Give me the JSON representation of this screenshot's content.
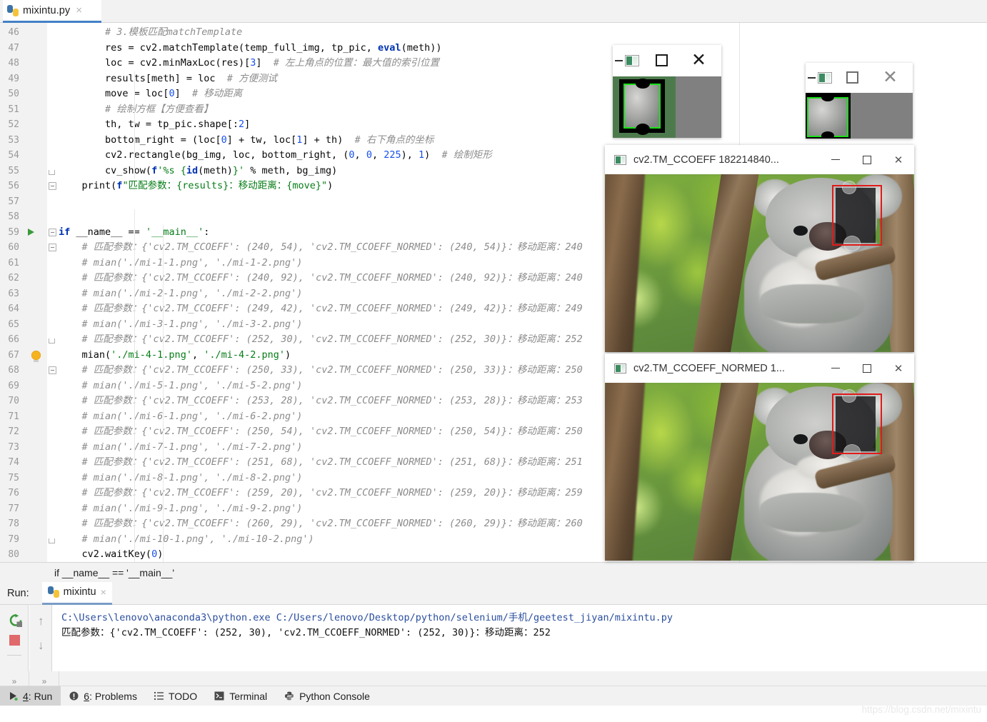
{
  "window": {
    "tab": {
      "filename": "mixintu.py",
      "close": "×",
      "icon": "python-file-icon"
    }
  },
  "editor": {
    "lines": [
      {
        "n": 46,
        "indent": 2,
        "segs": [
          {
            "t": "# 3.模板匹配matchTemplate",
            "c": "cmt"
          }
        ]
      },
      {
        "n": 47,
        "indent": 2,
        "segs": [
          {
            "t": "res = cv2.matchTemplate(temp_full_img, tp_pic, ",
            "c": ""
          },
          {
            "t": "eval",
            "c": "kw"
          },
          {
            "t": "(meth))",
            "c": ""
          }
        ]
      },
      {
        "n": 48,
        "indent": 2,
        "segs": [
          {
            "t": "loc = cv2.minMaxLoc(res)[",
            "c": ""
          },
          {
            "t": "3",
            "c": "num"
          },
          {
            "t": "]  ",
            "c": ""
          },
          {
            "t": "# 左上角点的位置：最大值的索引位置",
            "c": "cmt"
          }
        ]
      },
      {
        "n": 49,
        "indent": 2,
        "segs": [
          {
            "t": "results[meth] = loc  ",
            "c": ""
          },
          {
            "t": "# 方便测试",
            "c": "cmt"
          }
        ]
      },
      {
        "n": 50,
        "indent": 2,
        "segs": [
          {
            "t": "move = loc[",
            "c": ""
          },
          {
            "t": "0",
            "c": "num"
          },
          {
            "t": "]  ",
            "c": ""
          },
          {
            "t": "# 移动距离",
            "c": "cmt"
          }
        ]
      },
      {
        "n": 51,
        "indent": 2,
        "segs": [
          {
            "t": "# 绘制方框【方便查看】",
            "c": "cmt"
          }
        ]
      },
      {
        "n": 52,
        "indent": 2,
        "segs": [
          {
            "t": "th, tw = tp_pic.shape[:",
            "c": ""
          },
          {
            "t": "2",
            "c": "num"
          },
          {
            "t": "]",
            "c": ""
          }
        ]
      },
      {
        "n": 53,
        "indent": 2,
        "segs": [
          {
            "t": "bottom_right = (loc[",
            "c": ""
          },
          {
            "t": "0",
            "c": "num"
          },
          {
            "t": "] + tw, loc[",
            "c": ""
          },
          {
            "t": "1",
            "c": "num"
          },
          {
            "t": "] + th)  ",
            "c": ""
          },
          {
            "t": "# 右下角点的坐标",
            "c": "cmt"
          }
        ]
      },
      {
        "n": 54,
        "indent": 2,
        "segs": [
          {
            "t": "cv2.rectangle(bg_img, loc, bottom_right, (",
            "c": ""
          },
          {
            "t": "0",
            "c": "num"
          },
          {
            "t": ", ",
            "c": ""
          },
          {
            "t": "0",
            "c": "num"
          },
          {
            "t": ", ",
            "c": ""
          },
          {
            "t": "225",
            "c": "num"
          },
          {
            "t": "), ",
            "c": ""
          },
          {
            "t": "1",
            "c": "num"
          },
          {
            "t": ")  ",
            "c": ""
          },
          {
            "t": "# 绘制矩形",
            "c": "cmt"
          }
        ]
      },
      {
        "n": 55,
        "indent": 2,
        "segs": [
          {
            "t": "cv_show(",
            "c": ""
          },
          {
            "t": "f",
            "c": "kw"
          },
          {
            "t": "'%s {",
            "c": "str"
          },
          {
            "t": "id",
            "c": "kw"
          },
          {
            "t": "(meth)",
            "c": ""
          },
          {
            "t": "}'",
            "c": "str"
          },
          {
            "t": " % meth, bg_img)",
            "c": ""
          }
        ]
      },
      {
        "n": 56,
        "indent": 1,
        "segs": [
          {
            "t": "print(",
            "c": ""
          },
          {
            "t": "f",
            "c": "kw"
          },
          {
            "t": "\"匹配参数：{results}：移动距离：{move}\"",
            "c": "str"
          },
          {
            "t": ")",
            "c": ""
          }
        ]
      },
      {
        "n": 57,
        "indent": 0,
        "segs": []
      },
      {
        "n": 58,
        "indent": 0,
        "segs": []
      },
      {
        "n": 59,
        "indent": 0,
        "segs": [
          {
            "t": "if",
            "c": "kw"
          },
          {
            "t": " __name__ == ",
            "c": ""
          },
          {
            "t": "'__main__'",
            "c": "str"
          },
          {
            "t": ":",
            "c": ""
          }
        ]
      },
      {
        "n": 60,
        "indent": 1,
        "segs": [
          {
            "t": "# 匹配参数：{'cv2.TM_CCOEFF': (240, 54), 'cv2.TM_CCOEFF_NORMED': (240, 54)}：移动距离：240",
            "c": "cmt"
          }
        ]
      },
      {
        "n": 61,
        "indent": 1,
        "segs": [
          {
            "t": "# mian('./mi-1-1.png', './mi-1-2.png')",
            "c": "cmt"
          }
        ]
      },
      {
        "n": 62,
        "indent": 1,
        "segs": [
          {
            "t": "# 匹配参数：{'cv2.TM_CCOEFF': (240, 92), 'cv2.TM_CCOEFF_NORMED': (240, 92)}：移动距离：240",
            "c": "cmt"
          }
        ]
      },
      {
        "n": 63,
        "indent": 1,
        "segs": [
          {
            "t": "# mian('./mi-2-1.png', './mi-2-2.png')",
            "c": "cmt"
          }
        ]
      },
      {
        "n": 64,
        "indent": 1,
        "segs": [
          {
            "t": "# 匹配参数：{'cv2.TM_CCOEFF': (249, 42), 'cv2.TM_CCOEFF_NORMED': (249, 42)}：移动距离：249",
            "c": "cmt"
          }
        ]
      },
      {
        "n": 65,
        "indent": 1,
        "segs": [
          {
            "t": "# mian('./mi-3-1.png', './mi-3-2.png')",
            "c": "cmt"
          }
        ]
      },
      {
        "n": 66,
        "indent": 1,
        "segs": [
          {
            "t": "# 匹配参数：{'cv2.TM_CCOEFF': (252, 30), 'cv2.TM_CCOEFF_NORMED': (252, 30)}：移动距离：252",
            "c": "cmt"
          }
        ]
      },
      {
        "n": 67,
        "indent": 1,
        "segs": [
          {
            "t": "mian(",
            "c": ""
          },
          {
            "t": "'./mi-4-1.png'",
            "c": "str"
          },
          {
            "t": ", ",
            "c": ""
          },
          {
            "t": "'./mi-4-2.png'",
            "c": "str"
          },
          {
            "t": ")",
            "c": ""
          }
        ]
      },
      {
        "n": 68,
        "indent": 1,
        "segs": [
          {
            "t": "# 匹配参数：{'cv2.TM_CCOEFF': (250, 33), 'cv2.TM_CCOEFF_NORMED': (250, 33)}：移动距离：250",
            "c": "cmt"
          }
        ]
      },
      {
        "n": 69,
        "indent": 1,
        "segs": [
          {
            "t": "# mian('./mi-5-1.png', './mi-5-2.png')",
            "c": "cmt"
          }
        ]
      },
      {
        "n": 70,
        "indent": 1,
        "segs": [
          {
            "t": "# 匹配参数：{'cv2.TM_CCOEFF': (253, 28), 'cv2.TM_CCOEFF_NORMED': (253, 28)}：移动距离：253",
            "c": "cmt"
          }
        ]
      },
      {
        "n": 71,
        "indent": 1,
        "segs": [
          {
            "t": "# mian('./mi-6-1.png', './mi-6-2.png')",
            "c": "cmt"
          }
        ]
      },
      {
        "n": 72,
        "indent": 1,
        "segs": [
          {
            "t": "# 匹配参数：{'cv2.TM_CCOEFF': (250, 54), 'cv2.TM_CCOEFF_NORMED': (250, 54)}：移动距离：250",
            "c": "cmt"
          }
        ]
      },
      {
        "n": 73,
        "indent": 1,
        "segs": [
          {
            "t": "# mian('./mi-7-1.png', './mi-7-2.png')",
            "c": "cmt"
          }
        ]
      },
      {
        "n": 74,
        "indent": 1,
        "segs": [
          {
            "t": "# 匹配参数：{'cv2.TM_CCOEFF': (251, 68), 'cv2.TM_CCOEFF_NORMED': (251, 68)}：移动距离：251",
            "c": "cmt"
          }
        ]
      },
      {
        "n": 75,
        "indent": 1,
        "segs": [
          {
            "t": "# mian('./mi-8-1.png', './mi-8-2.png')",
            "c": "cmt"
          }
        ]
      },
      {
        "n": 76,
        "indent": 1,
        "segs": [
          {
            "t": "# 匹配参数：{'cv2.TM_CCOEFF': (259, 20), 'cv2.TM_CCOEFF_NORMED': (259, 20)}：移动距离：259",
            "c": "cmt"
          }
        ]
      },
      {
        "n": 77,
        "indent": 1,
        "segs": [
          {
            "t": "# mian('./mi-9-1.png', './mi-9-2.png')",
            "c": "cmt"
          }
        ]
      },
      {
        "n": 78,
        "indent": 1,
        "segs": [
          {
            "t": "# 匹配参数：{'cv2.TM_CCOEFF': (260, 29), 'cv2.TM_CCOEFF_NORMED': (260, 29)}：移动距离：260",
            "c": "cmt"
          }
        ]
      },
      {
        "n": 79,
        "indent": 1,
        "segs": [
          {
            "t": "# mian('./mi-10-1.png', './mi-10-2.png')",
            "c": "cmt"
          }
        ]
      },
      {
        "n": 80,
        "indent": 1,
        "segs": [
          {
            "t": "cv2.waitKey(",
            "c": ""
          },
          {
            "t": "0",
            "c": "num"
          },
          {
            "t": ")",
            "c": ""
          }
        ]
      }
    ],
    "highlighted_line": 68,
    "run_arrow_line": 59,
    "bulb_line": 67
  },
  "breadcrumb": {
    "text": "if __name__ == '__main__'"
  },
  "run_panel": {
    "label": "Run:",
    "tab_name": "mixintu",
    "tab_close": "×",
    "console": {
      "command": "C:\\Users\\lenovo\\anaconda3\\python.exe C:/Users/lenovo/Desktop/python/selenium/手机/geetest_jiyan/mixintu.py",
      "output": "匹配参数：{'cv2.TM_CCOEFF': (252, 30), 'cv2.TM_CCOEFF_NORMED': (252, 30)}：移动距离：252"
    },
    "toolbar": {
      "rerun": "rerun-icon",
      "stop": "stop-icon",
      "up": "↑",
      "down": "↓",
      "expand_left": "»",
      "expand_right": "»"
    }
  },
  "statusbar": {
    "items": [
      {
        "num": "4",
        "label": ": Run",
        "icon": "run-triangle-icon",
        "active": true
      },
      {
        "num": "6",
        "label": ": Problems",
        "icon": "warning-icon",
        "active": false
      },
      {
        "num": "",
        "label": "TODO",
        "icon": "list-icon",
        "active": false
      },
      {
        "num": "",
        "label": "Terminal",
        "icon": "terminal-icon",
        "active": false
      },
      {
        "num": "",
        "label": "Python Console",
        "icon": "python-icon",
        "active": false
      }
    ]
  },
  "watermark": {
    "text": "https://blog.csdn.net/mixintu"
  },
  "cv_windows": [
    {
      "id": "tm-ccoeff-window",
      "title": "cv2.TM_CCOEFF 182214840...",
      "buttons": {
        "minimize": "—",
        "maximize": "□",
        "close": "✕"
      }
    },
    {
      "id": "tm-ccoeff-normed-window",
      "title": "cv2.TM_CCOEFF_NORMED 1...",
      "buttons": {
        "minimize": "—",
        "maximize": "□",
        "close": "✕"
      }
    }
  ],
  "template_windows": [
    {
      "id": "template-window-1",
      "buttons": {
        "minimize": "—",
        "maximize": "□",
        "close": "✕"
      }
    },
    {
      "id": "template-window-2",
      "buttons": {
        "minimize": "—",
        "maximize": "□",
        "close": "✕"
      }
    }
  ],
  "colors": {
    "accent": "#4380c6",
    "keyword": "#0033b3",
    "string": "#067d17",
    "comment": "#8c8c8c",
    "number": "#1750eb",
    "match_rect": "#e01b1b",
    "template_border": "#19e019",
    "stop": "#e0696b",
    "run_green": "#3a9a3a"
  }
}
